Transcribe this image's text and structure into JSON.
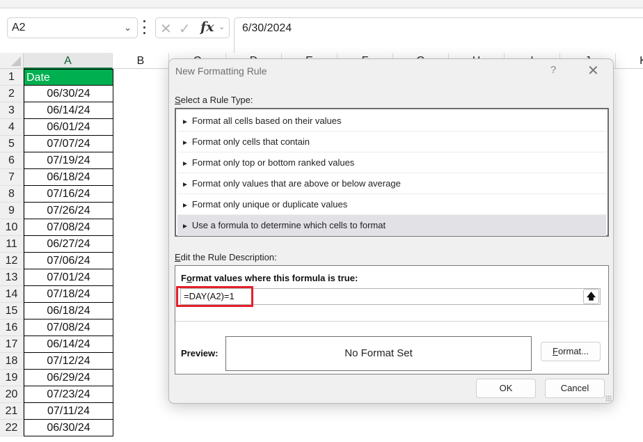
{
  "formula_bar": {
    "name_box": "A2",
    "formula_value": "6/30/2024",
    "icons": [
      "cancel-icon",
      "enter-icon",
      "function-icon"
    ]
  },
  "columns": [
    "A",
    "B",
    "C",
    "D",
    "E",
    "F",
    "G",
    "H",
    "I",
    "J",
    "K"
  ],
  "rows": [
    "1",
    "2",
    "3",
    "4",
    "5",
    "6",
    "7",
    "8",
    "9",
    "10",
    "11",
    "12",
    "13",
    "14",
    "15",
    "16",
    "17",
    "18",
    "19",
    "20",
    "21",
    "22"
  ],
  "sheet": {
    "header": "Date",
    "values": [
      "06/30/24",
      "06/14/24",
      "06/01/24",
      "07/07/24",
      "07/19/24",
      "06/18/24",
      "07/16/24",
      "07/26/24",
      "07/08/24",
      "06/27/24",
      "07/06/24",
      "07/01/24",
      "07/18/24",
      "06/18/24",
      "07/08/24",
      "06/14/24",
      "07/12/24",
      "06/29/24",
      "07/23/24",
      "07/11/24",
      "06/30/24"
    ]
  },
  "dialog": {
    "title": "New Formatting Rule",
    "help": "?",
    "close": "✕",
    "select_label_key": "S",
    "select_label_rest": "elect a Rule Type:",
    "rule_types": [
      {
        "label": "Format all cells based on their values",
        "selected": false
      },
      {
        "label": "Format only cells that contain",
        "selected": false
      },
      {
        "label": "Format only top or bottom ranked values",
        "selected": false
      },
      {
        "label": "Format only values that are above or below average",
        "selected": false
      },
      {
        "label": "Format only unique or duplicate values",
        "selected": false
      },
      {
        "label": "Use a formula to determine which cells to format",
        "selected": true
      }
    ],
    "edit_label_key": "E",
    "edit_label_rest": "dit the Rule Description:",
    "formula_heading_pre": "F",
    "formula_heading_key": "o",
    "formula_heading_rest": "rmat values where this formula is true:",
    "formula": "=DAY(A2)=1",
    "preview_label": "Preview:",
    "preview_text": "No Format Set",
    "format_button_key": "F",
    "format_button_rest": "ormat...",
    "ok_button": "OK",
    "cancel_button": "Cancel",
    "highlight_color": "#e3202b"
  },
  "colors": {
    "header_fill": "#00b050",
    "selected_rule": "#e1e1e6"
  }
}
